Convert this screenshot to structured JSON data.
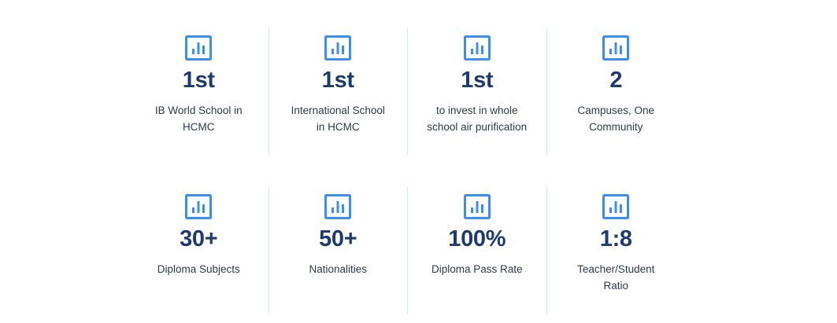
{
  "colors": {
    "icon_blue": "#3b8ff0",
    "value_navy": "#1e3a6e",
    "caption_text": "#2f3a4a",
    "divider": "#cfe6f7"
  },
  "stats": [
    {
      "icon": "bar-chart-icon",
      "value": "1st",
      "caption": "IB World School in HCMC"
    },
    {
      "icon": "bar-chart-icon",
      "value": "1st",
      "caption": "International School in HCMC"
    },
    {
      "icon": "bar-chart-icon",
      "value": "1st",
      "caption": "to invest in whole school air purification"
    },
    {
      "icon": "bar-chart-icon",
      "value": "2",
      "caption": "Campuses, One Community"
    },
    {
      "icon": "bar-chart-icon",
      "value": "30+",
      "caption": "Diploma Subjects"
    },
    {
      "icon": "bar-chart-icon",
      "value": "50+",
      "caption": "Nationalities"
    },
    {
      "icon": "bar-chart-icon",
      "value": "100%",
      "caption": "Diploma Pass Rate"
    },
    {
      "icon": "bar-chart-icon",
      "value": "1:8",
      "caption": "Teacher/Student Ratio"
    }
  ]
}
